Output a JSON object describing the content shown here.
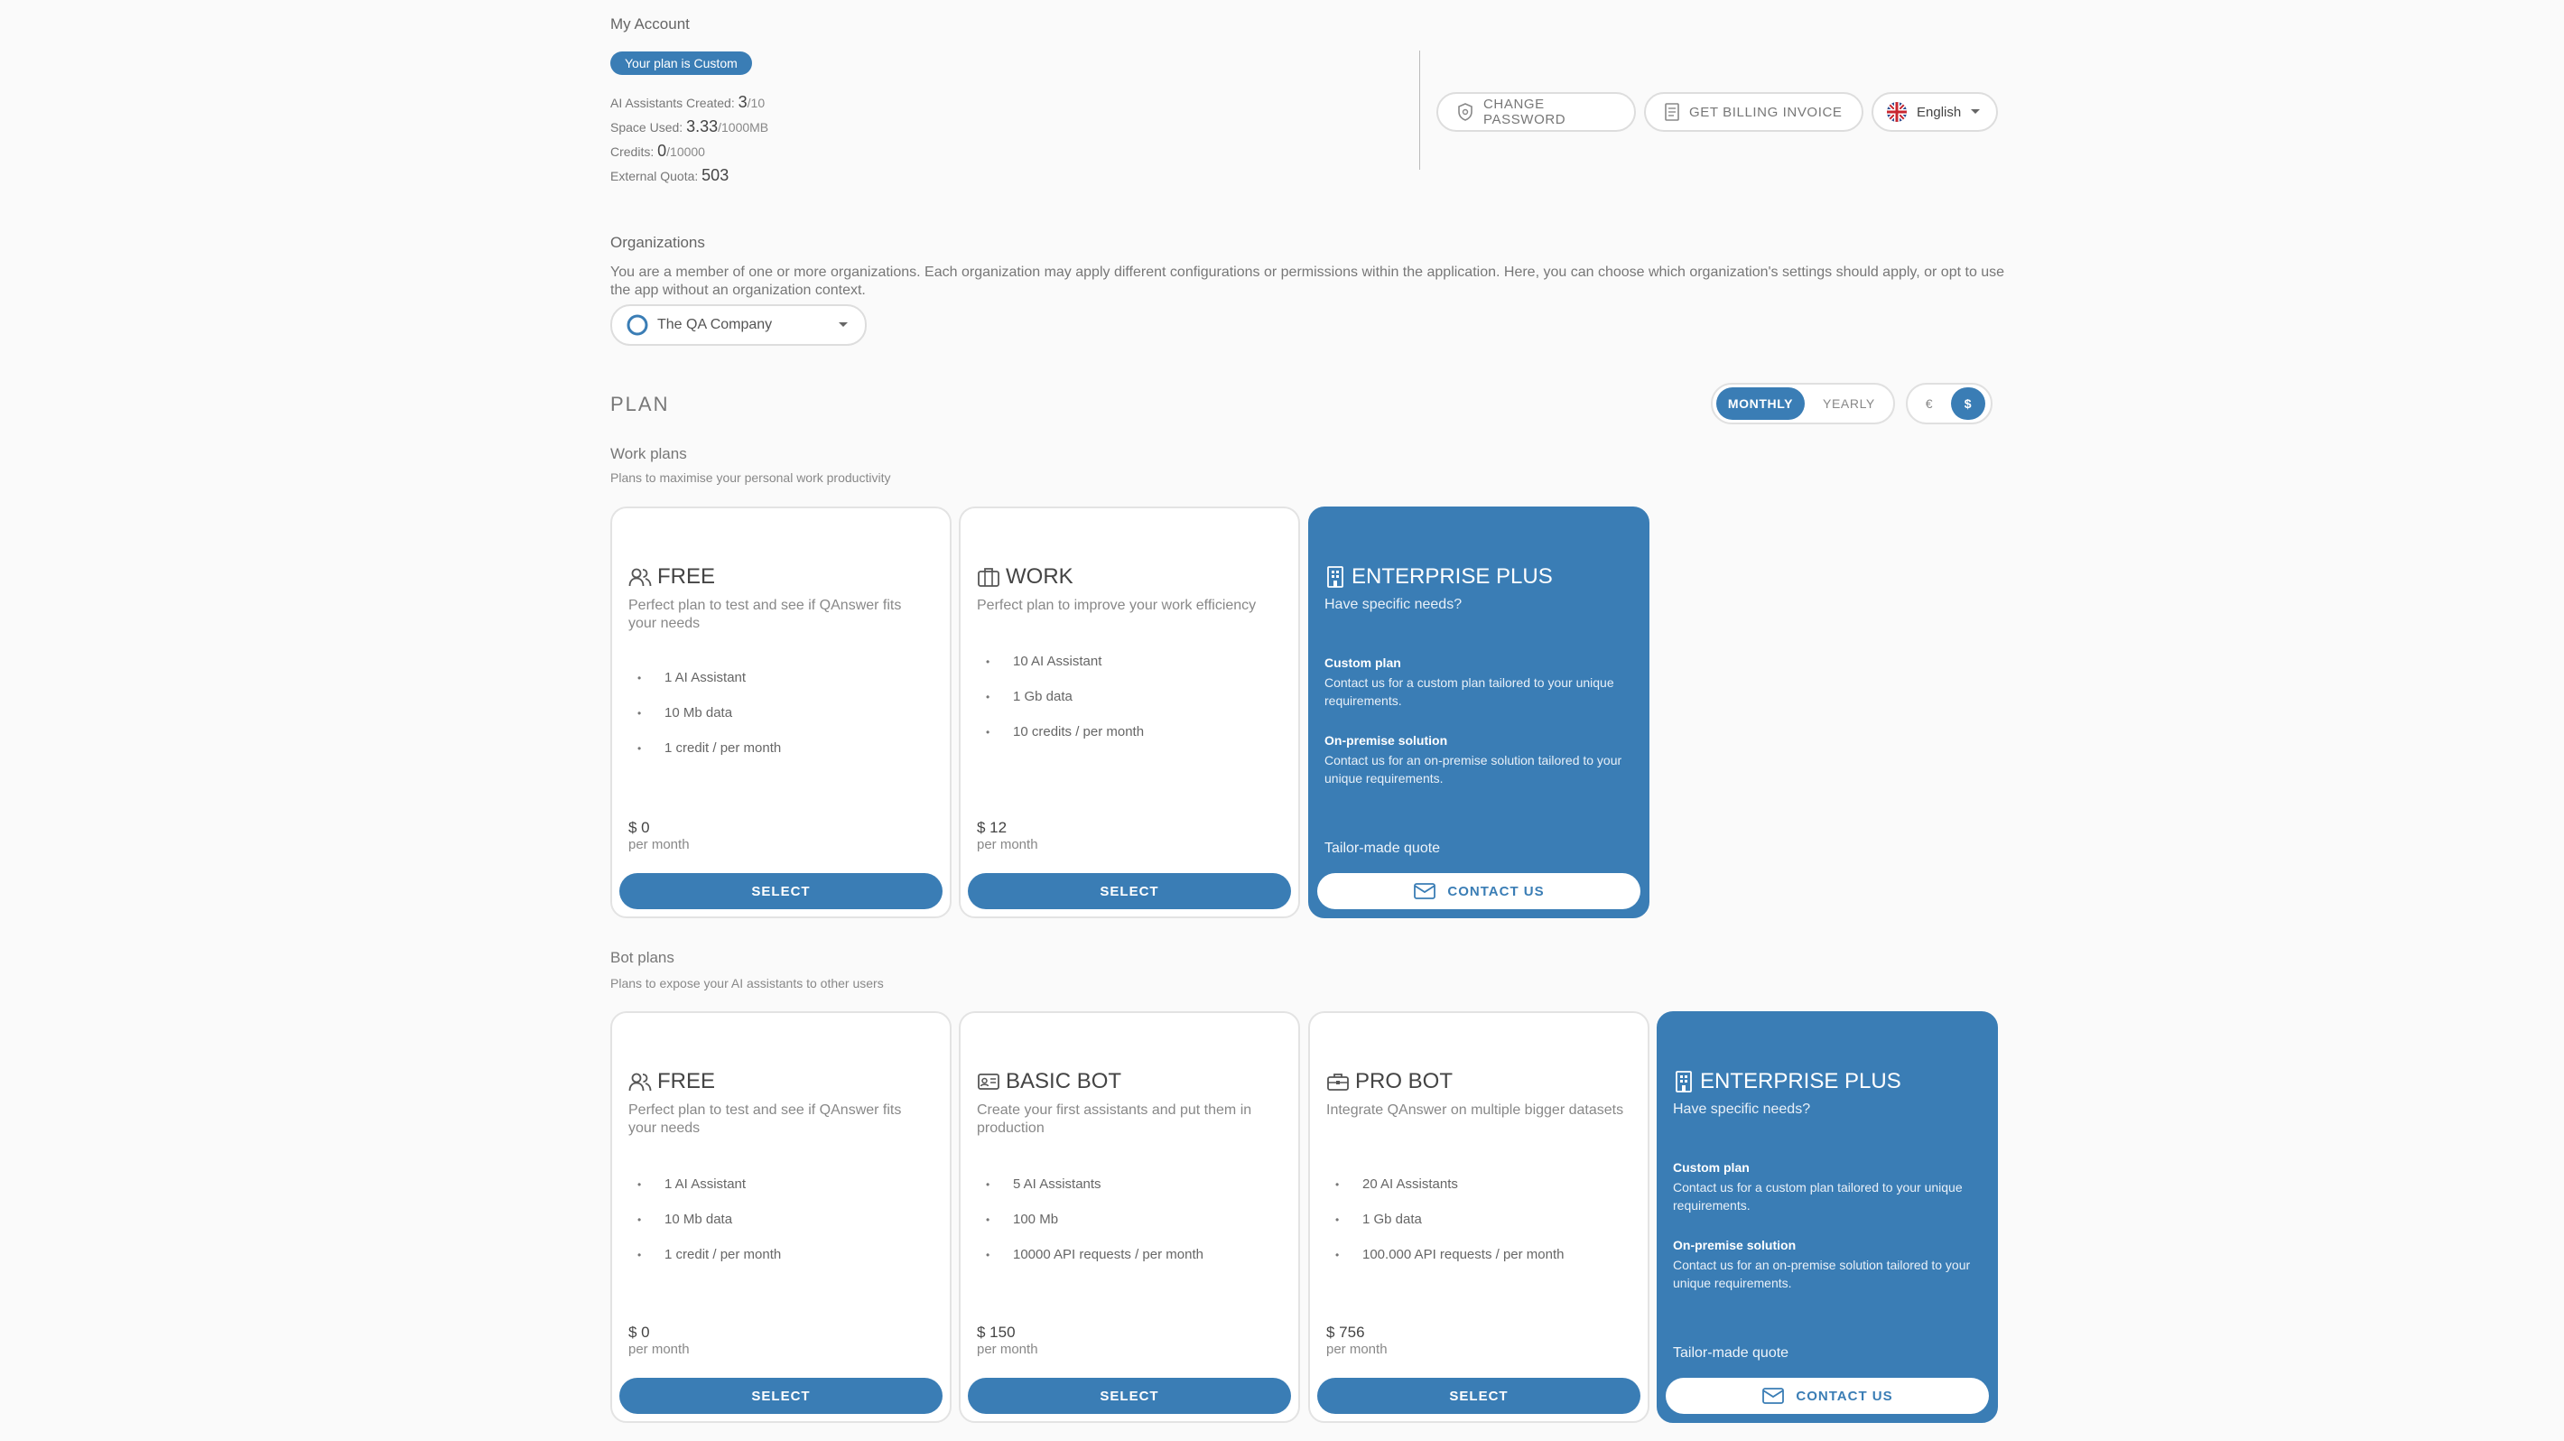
{
  "account": {
    "title": "My Account",
    "plan_chip": "Your plan is Custom",
    "stats": [
      {
        "label": "AI Assistants Created:",
        "value": "3",
        "suffix": "/10"
      },
      {
        "label": "Space Used:",
        "value": "3.33",
        "suffix": "/1000MB"
      },
      {
        "label": "Credits:",
        "value": "0",
        "suffix": "/10000"
      },
      {
        "label": "External Quota:",
        "value": "503",
        "suffix": ""
      }
    ],
    "actions": {
      "change_password": "CHANGE PASSWORD",
      "billing_invoice": "GET BILLING INVOICE",
      "language": "English"
    }
  },
  "organizations": {
    "title": "Organizations",
    "description": "You are a member of one or more organizations. Each organization may apply different configurations or permissions within the application. Here, you can choose which organization's settings should apply, or opt to use the app without an organization context.",
    "selected": "The QA Company"
  },
  "plan": {
    "heading": "PLAN",
    "billing_options": [
      "MONTHLY",
      "YEARLY"
    ],
    "billing_selected": "MONTHLY",
    "currency_options": [
      "€",
      "$"
    ],
    "currency_selected": "$"
  },
  "work_plans": {
    "title": "Work plans",
    "subtitle": "Plans to maximise your personal work productivity",
    "cards": [
      {
        "title": "FREE",
        "icon": "users-icon",
        "description": "Perfect plan to test and see if QAnswer fits your needs",
        "features": [
          "1 AI Assistant",
          "10 Mb data",
          "1 credit / per month"
        ],
        "price": "$ 0",
        "period": "per month",
        "button": "SELECT"
      },
      {
        "title": "WORK",
        "icon": "briefcase-icon",
        "description": "Perfect plan to improve your work efficiency",
        "features": [
          "10 AI Assistant",
          "1 Gb data",
          "10 credits / per month"
        ],
        "price": "$ 12",
        "period": "per month",
        "button": "SELECT"
      }
    ],
    "enterprise": {
      "title": "ENTERPRISE PLUS",
      "needs": "Have specific needs?",
      "custom_title": "Custom plan",
      "custom_text": "Contact us for a custom plan tailored to your unique requirements.",
      "onprem_title": "On-premise solution",
      "onprem_text": "Contact us for an on-premise solution tailored to your unique requirements.",
      "quote": "Tailor-made quote",
      "button": "CONTACT US"
    }
  },
  "bot_plans": {
    "title": "Bot plans",
    "subtitle": "Plans to expose your AI assistants to other users",
    "cards": [
      {
        "title": "FREE",
        "icon": "users-icon",
        "description": "Perfect plan to test and see if QAnswer fits your needs",
        "features": [
          "1 AI Assistant",
          "10 Mb data",
          "1 credit / per month"
        ],
        "price": "$ 0",
        "period": "per month",
        "button": "SELECT"
      },
      {
        "title": "BASIC BOT",
        "icon": "id-card-icon",
        "description": "Create your first assistants and put them in production",
        "features": [
          "5 AI Assistants",
          "100 Mb",
          "10000 API requests / per month"
        ],
        "price": "$ 150",
        "period": "per month",
        "button": "SELECT"
      },
      {
        "title": "PRO BOT",
        "icon": "toolbox-icon",
        "description": "Integrate QAnswer on multiple bigger datasets",
        "features": [
          "20 AI Assistants",
          "1 Gb data",
          "100.000 API requests / per month"
        ],
        "price": "$ 756",
        "period": "per month",
        "button": "SELECT"
      }
    ],
    "enterprise": {
      "title": "ENTERPRISE PLUS",
      "needs": "Have specific needs?",
      "custom_title": "Custom plan",
      "custom_text": "Contact us for a custom plan tailored to your unique requirements.",
      "onprem_title": "On-premise solution",
      "onprem_text": "Contact us for an on-premise solution tailored to your unique requirements.",
      "quote": "Tailor-made quote",
      "button": "CONTACT US"
    }
  },
  "colors": {
    "primary": "#3a7db5",
    "background": "#fafafa",
    "card_border": "#e3e3e3"
  }
}
